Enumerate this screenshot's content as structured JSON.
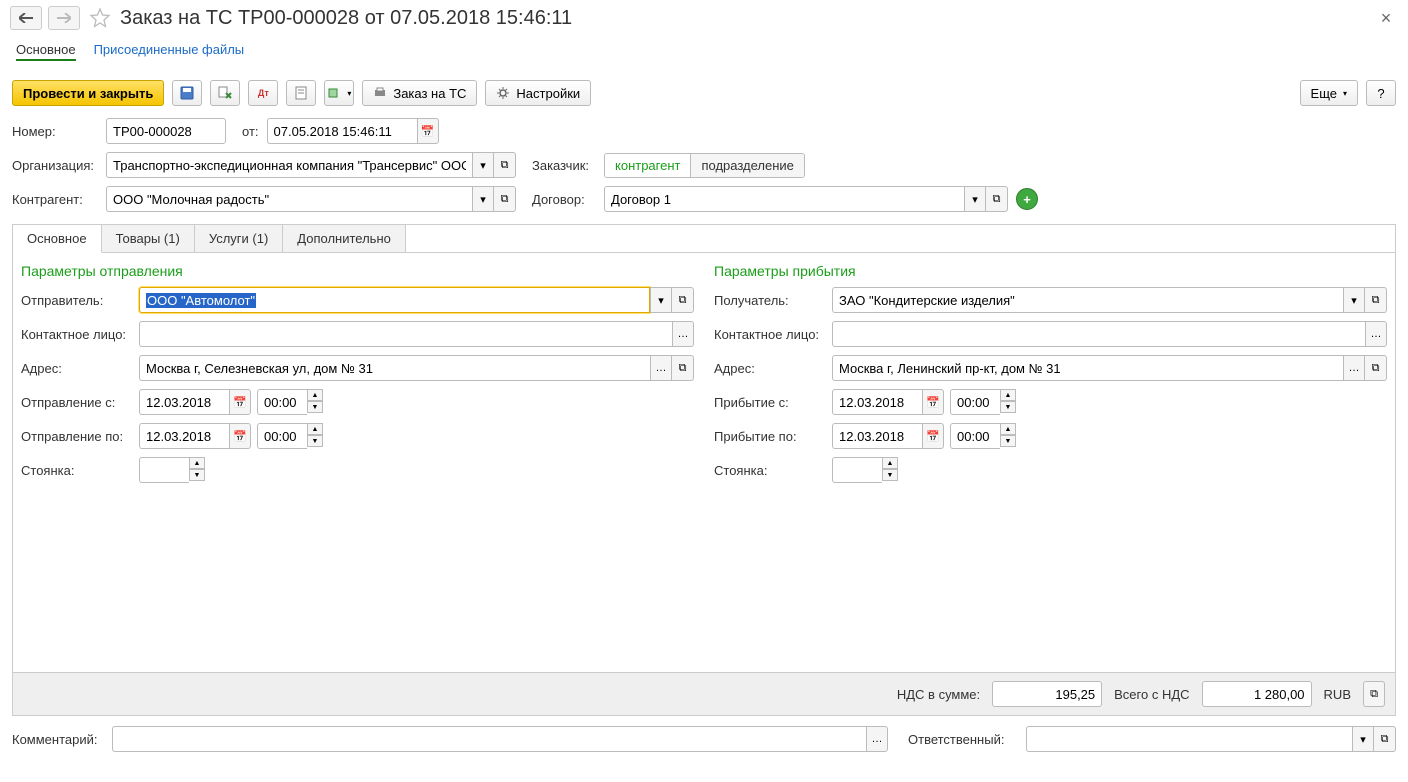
{
  "header": {
    "title": "Заказ на ТС ТР00-000028 от 07.05.2018 15:46:11"
  },
  "nav": {
    "main": "Основное",
    "attached": "Присоединенные файлы"
  },
  "toolbar": {
    "post_close": "Провести и закрыть",
    "order_ts": "Заказ на ТС",
    "settings": "Настройки",
    "more": "Еще",
    "help": "?"
  },
  "fields": {
    "number_label": "Номер:",
    "number": "ТР00-000028",
    "from_label": "от:",
    "date": "07.05.2018 15:46:11",
    "org_label": "Организация:",
    "org": "Транспортно-экспедиционная компания \"Трансервис\" ООО",
    "customer_label": "Заказчик:",
    "toggle_contractor": "контрагент",
    "toggle_division": "подразделение",
    "contractor_label": "Контрагент:",
    "contractor": "ООО \"Молочная радость\"",
    "contract_label": "Договор:",
    "contract": "Договор 1"
  },
  "tabs": {
    "main": "Основное",
    "goods": "Товары (1)",
    "services": "Услуги (1)",
    "extra": "Дополнительно"
  },
  "departure": {
    "title": "Параметры отправления",
    "sender_label": "Отправитель:",
    "sender": "ООО \"Автомолот\"",
    "contact_label": "Контактное лицо:",
    "contact": "",
    "address_label": "Адрес:",
    "address": "Москва г, Селезневская ул, дом № 31",
    "dep_from_label": "Отправление с:",
    "dep_to_label": "Отправление по:",
    "date_from": "12.03.2018",
    "time_from": "00:00",
    "date_to": "12.03.2018",
    "time_to": "00:00",
    "parking_label": "Стоянка:",
    "parking": ""
  },
  "arrival": {
    "title": "Параметры прибытия",
    "receiver_label": "Получатель:",
    "receiver": "ЗАО \"Кондитерские изделия\"",
    "contact_label": "Контактное лицо:",
    "contact": "",
    "address_label": "Адрес:",
    "address": "Москва г, Ленинский пр-кт, дом № 31",
    "arr_from_label": "Прибытие с:",
    "arr_to_label": "Прибытие по:",
    "date_from": "12.03.2018",
    "time_from": "00:00",
    "date_to": "12.03.2018",
    "time_to": "00:00",
    "parking_label": "Стоянка:",
    "parking": ""
  },
  "summary": {
    "nds_label": "НДС в сумме:",
    "nds": "195,25",
    "total_label": "Всего с НДС",
    "total": "1 280,00",
    "currency": "RUB"
  },
  "footer": {
    "comment_label": "Комментарий:",
    "comment": "",
    "responsible_label": "Ответственный:",
    "responsible": ""
  }
}
